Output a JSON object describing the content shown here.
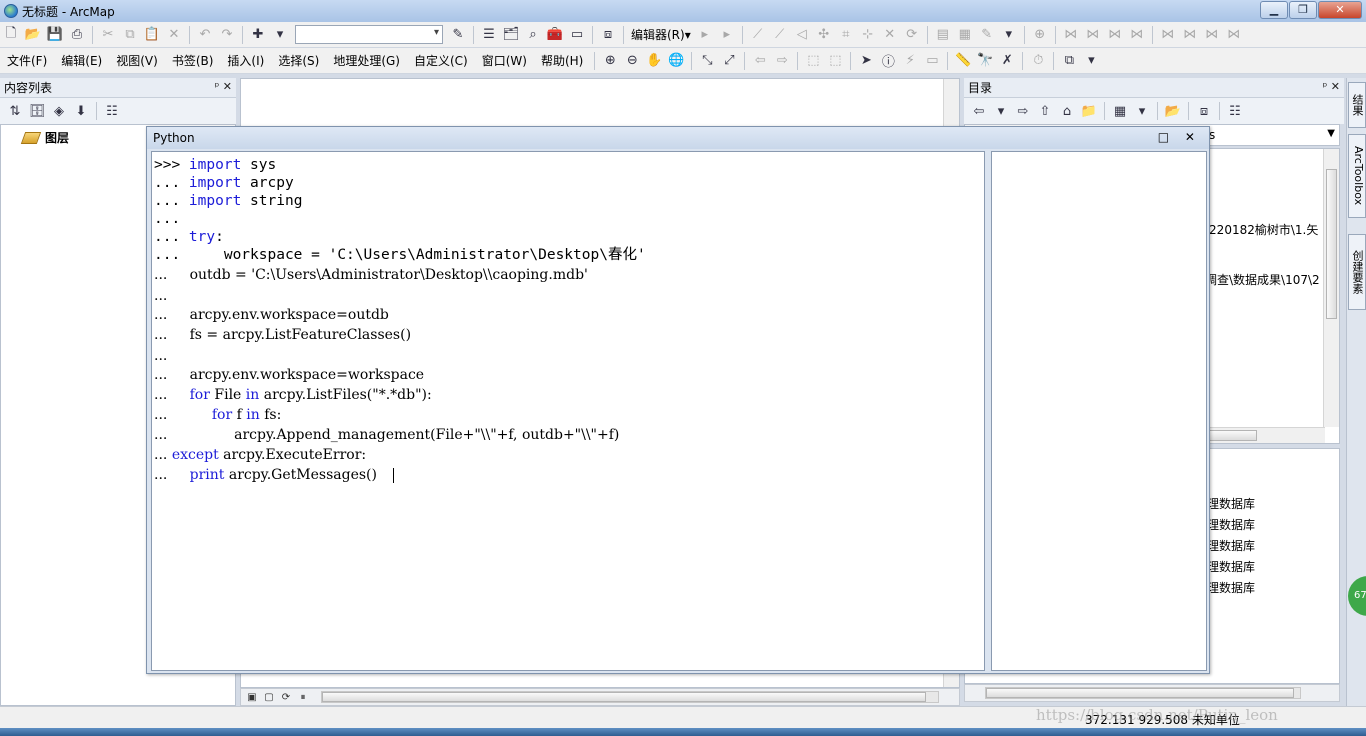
{
  "window": {
    "title": "无标题 - ArcMap",
    "min": "▁",
    "max": "❐",
    "close": "✕"
  },
  "toolbar": {
    "editor_label": "编辑器(R)▾"
  },
  "menu": {
    "items": [
      "文件(F)",
      "编辑(E)",
      "视图(V)",
      "书签(B)",
      "插入(I)",
      "选择(S)",
      "地理处理(G)",
      "自定义(C)",
      "窗口(W)",
      "帮助(H)"
    ]
  },
  "toc": {
    "title": "内容列表",
    "pin": "ᵖ ✕",
    "layer": "图层"
  },
  "catalog": {
    "title": "目录",
    "pin": "ᵖ ✕",
    "combo_text": "s",
    "paths": [
      "\\220182榆树市\\1.矢",
      "调查\\数据成果\\107\\2"
    ],
    "list": [
      "理数据库",
      "理数据库",
      "理数据库",
      "理数据库",
      "理数据库"
    ]
  },
  "dock": {
    "tab1": "结果",
    "tab2": "ArcToolbox",
    "tab3": "创建要素",
    "badge": "67"
  },
  "python": {
    "title": "Python",
    "controls": "□ ✕",
    "lines": [
      {
        "p": ">>> ",
        "k": "import",
        "r": " sys",
        "serif": false
      },
      {
        "p": "... ",
        "k": "import",
        "r": " arcpy",
        "serif": false
      },
      {
        "p": "... ",
        "k": "import",
        "r": " string",
        "serif": false
      },
      {
        "p": "...",
        "k": "",
        "r": "",
        "serif": false
      },
      {
        "p": "... ",
        "k": "try",
        "r": ":",
        "serif": false
      },
      {
        "p": "...     ",
        "k": "",
        "r": "workspace = 'C:\\Users\\Administrator\\Desktop\\春化'",
        "serif": false
      },
      {
        "p": "...     ",
        "k": "",
        "r": "outdb = 'C:\\Users\\Administrator\\Desktop\\\\caoping.mdb'",
        "serif": true
      },
      {
        "p": "...",
        "k": "",
        "r": "",
        "serif": true
      },
      {
        "p": "...     ",
        "k": "",
        "r": "arcpy.env.workspace=outdb",
        "serif": true
      },
      {
        "p": "...     ",
        "k": "",
        "r": "fs = arcpy.ListFeatureClasses()",
        "serif": true
      },
      {
        "p": "...",
        "k": "",
        "r": "",
        "serif": true
      },
      {
        "p": "...     ",
        "k": "",
        "r": "arcpy.env.workspace=workspace",
        "serif": true
      },
      {
        "p": "...     ",
        "k": "for",
        "r": " File in arcpy.ListFiles(\"*.*db\"):",
        "serif": true
      },
      {
        "p": "...          ",
        "k": "for",
        "r": " f in fs:",
        "serif": true
      },
      {
        "p": "...               ",
        "k": "",
        "r": "arcpy.Append_management(File+\"\\\\\"+f, outdb+\"\\\\\"+f)",
        "serif": true
      },
      {
        "p": "... ",
        "k": "except",
        "r": " arcpy.ExecuteError:",
        "serif": true
      },
      {
        "p": "...     ",
        "k": "print",
        "r": " arcpy.GetMessages()",
        "serif": true
      }
    ]
  },
  "status": {
    "coords": "372.131  929.508 未知单位",
    "watermark": "https://blog.csdn.net/Putin_leon"
  }
}
